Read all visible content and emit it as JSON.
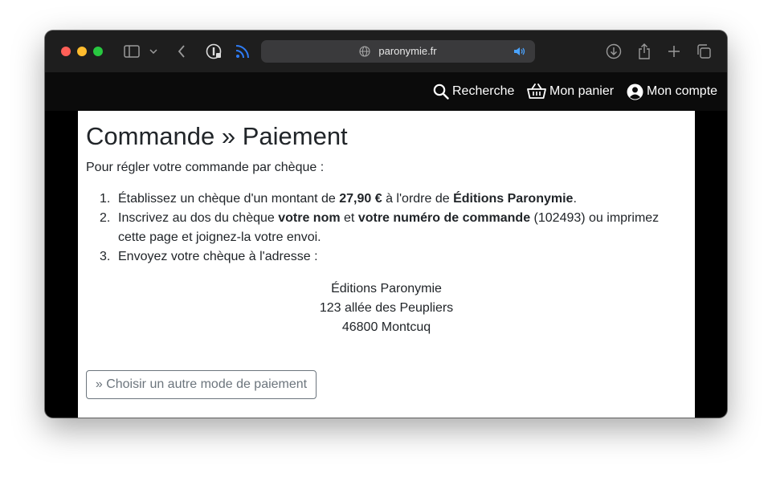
{
  "browser": {
    "url": "paronymie.fr"
  },
  "nav": {
    "search_label": "Recherche",
    "cart_label": "Mon panier",
    "account_label": "Mon compte"
  },
  "page": {
    "title": "Commande » Paiement",
    "intro": "Pour régler votre commande par chèque :",
    "steps": [
      {
        "num": "1.",
        "parts": [
          "Établissez un chèque d'un montant de ",
          "27,90 €",
          " à l'ordre de ",
          "Éditions Paronymie",
          "."
        ]
      },
      {
        "num": "2.",
        "parts": [
          "Inscrivez au dos du chèque ",
          "votre nom",
          " et ",
          "votre numéro de commande",
          " (102493) ou imprimez cette page et joignez-la votre envoi."
        ]
      },
      {
        "num": "3.",
        "parts": [
          "Envoyez votre chèque à l'adresse :"
        ]
      }
    ],
    "address": {
      "line1": "Éditions Paronymie",
      "line2": "123 allée des Peupliers",
      "line3": "46800 Montcuq"
    },
    "alt_payment_button": "» Choisir un autre mode de paiement"
  },
  "icons": {
    "sidebar": "sidebar-icon",
    "back": "chevron-left-icon",
    "password": "password-manager-icon",
    "rss": "rss-icon",
    "globe": "globe-icon",
    "audio": "speaker-icon",
    "download": "download-icon",
    "share": "share-icon",
    "new_tab": "plus-icon",
    "tabs": "tab-overview-icon",
    "search": "search-icon",
    "cart": "basket-icon",
    "account": "user-circle-icon"
  },
  "colors": {
    "toolbar_bg": "#1e1e1e",
    "navbar_bg": "#0b0b0b",
    "button_border": "#6c757d",
    "rss_blue": "#2f7cf6"
  }
}
